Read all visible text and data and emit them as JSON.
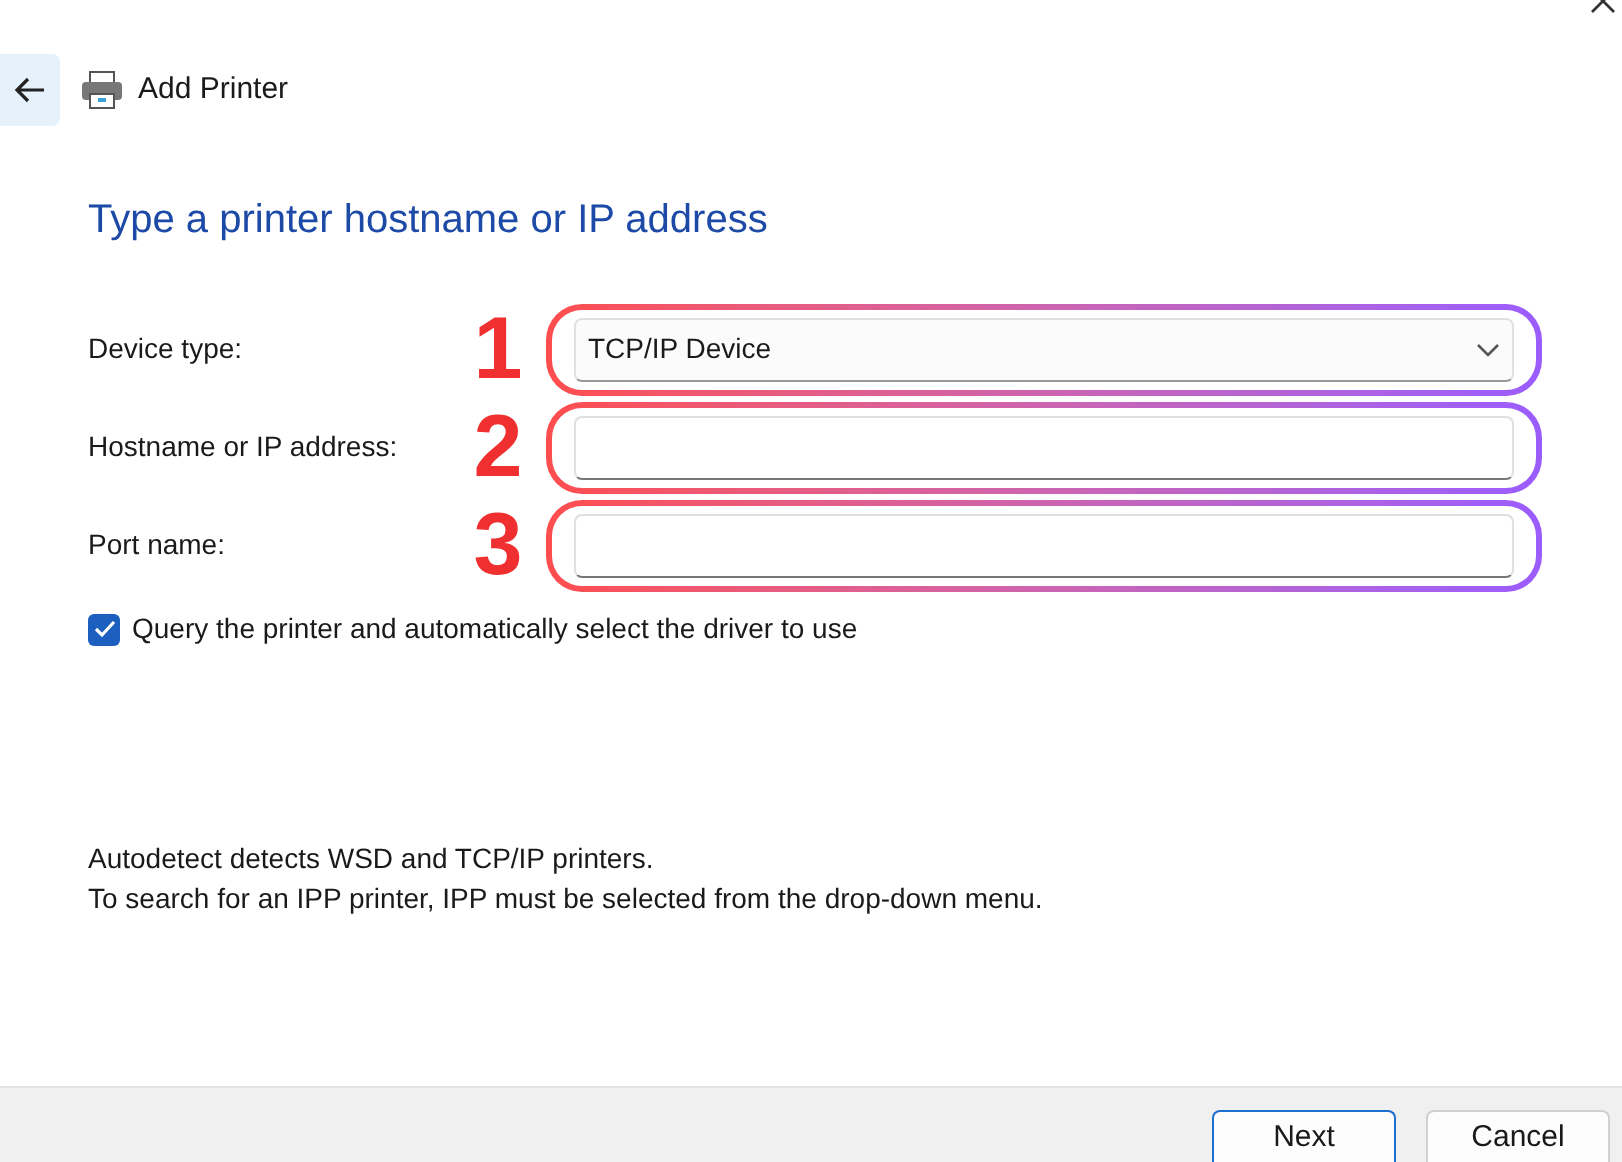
{
  "window": {
    "title": "Add Printer"
  },
  "heading": "Type a printer hostname or IP address",
  "fields": [
    {
      "kind": "dropdown",
      "label": "Device type:",
      "value": "TCP/IP Device",
      "annotation": "1"
    },
    {
      "kind": "text",
      "label": "Hostname or IP address:",
      "annotation": "2"
    },
    {
      "kind": "text",
      "label": "Port name:",
      "annotation": "3"
    }
  ],
  "query_option": {
    "label": "Query the printer and automatically select the driver to use",
    "checked": true
  },
  "notes": [
    "Autodetect detects WSD and TCP/IP printers.",
    "To search for an IPP printer, IPP must be selected from the drop-down menu."
  ],
  "buttons": [
    {
      "label": "Next",
      "selected": true
    },
    {
      "label": "Cancel",
      "selected": false
    }
  ]
}
